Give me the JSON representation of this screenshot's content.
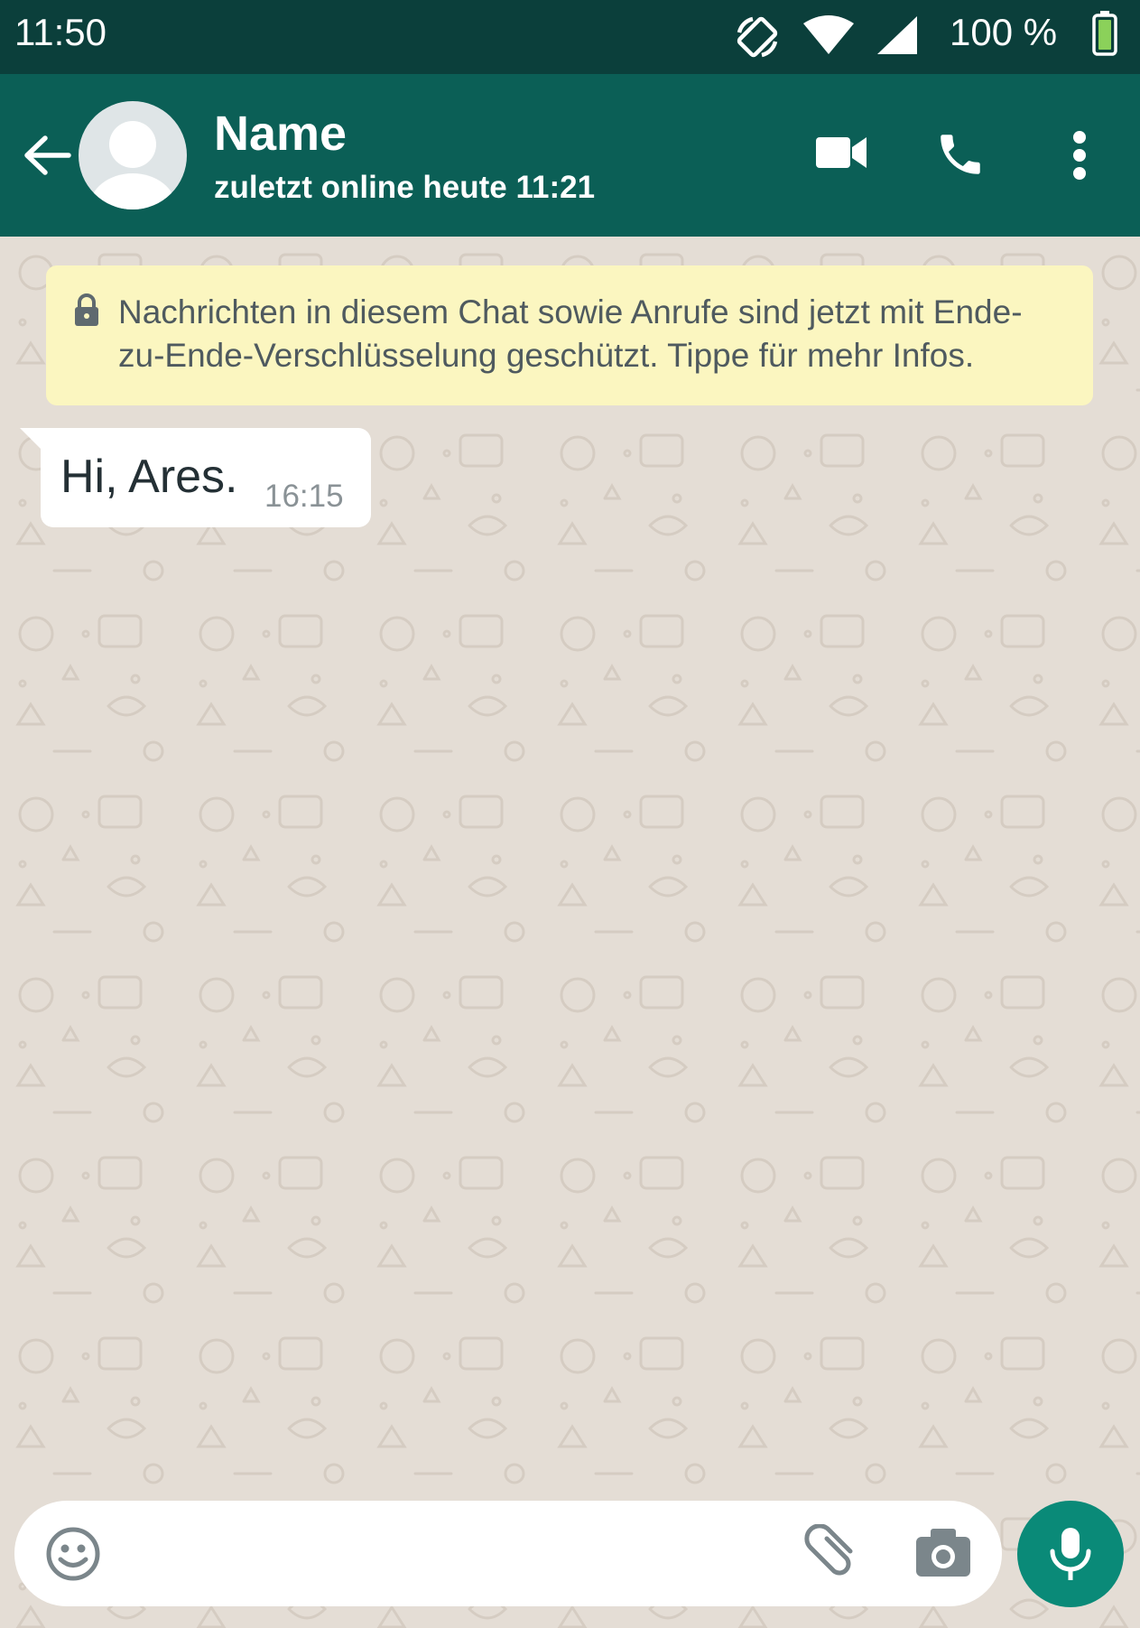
{
  "status_bar": {
    "time": "11:50",
    "battery_text": "100 %",
    "icons": [
      "screen-rotate-icon",
      "wifi-icon",
      "cellular-signal-icon",
      "battery-icon"
    ]
  },
  "header": {
    "contact_name": "Name",
    "last_seen": "zuletzt online heute 11:21",
    "icons": [
      "back-arrow-icon",
      "avatar",
      "video-call-icon",
      "voice-call-icon",
      "more-options-icon"
    ]
  },
  "encryption_notice": {
    "text": "Nachrichten in diesem Chat sowie Anrufe sind jetzt mit Ende-zu-Ende-Verschlüsselung geschützt. Tippe für mehr Infos.",
    "icon": "lock-icon"
  },
  "messages": [
    {
      "direction": "incoming",
      "text": "Hi, Ares.",
      "time": "16:15"
    }
  ],
  "composer": {
    "placeholder": "",
    "icons": [
      "emoji-icon",
      "attach-icon",
      "camera-icon",
      "microphone-icon"
    ]
  },
  "colors": {
    "status_bar": "#0b3f3b",
    "app_bar": "#0b5f56",
    "chat_background": "#e4ddd5",
    "notice_background": "#fbf6c0",
    "mic_button": "#0a8a78"
  }
}
